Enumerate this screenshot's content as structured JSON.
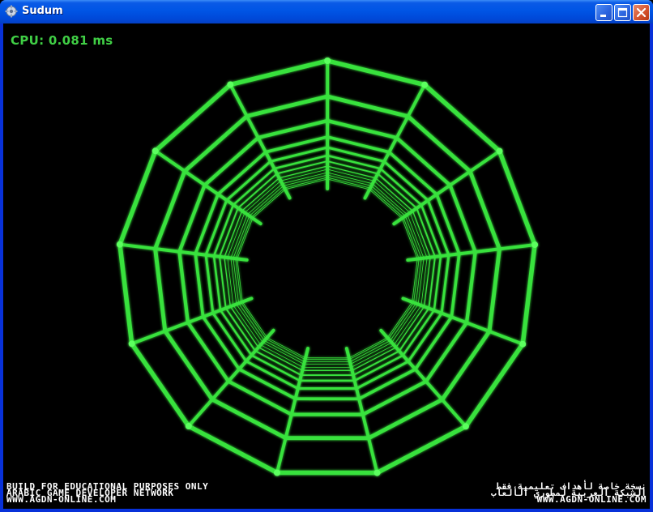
{
  "window": {
    "title": "Sudum",
    "buttons": {
      "minimize": "minimize",
      "maximize": "maximize",
      "close": "close"
    }
  },
  "hud": {
    "cpu_label": "CPU: 0.081 ms"
  },
  "tunnel": {
    "color": "#39e23c",
    "rings": 13,
    "spokes": 13
  },
  "footer": {
    "left_lines": [
      "BUILD FOR EDUCATIONAL PURPOSES ONLY",
      "ARABIC GAME DEVELOPER NETWORK",
      "WWW.AGDN-ONLINE.COM"
    ],
    "right_lines": [
      "نسخة خاصة لأهداف تعليمية فقط",
      "الشبكة العربية لمطوري الألعاب",
      "WWW.AGDN-ONLINE.COM"
    ]
  }
}
